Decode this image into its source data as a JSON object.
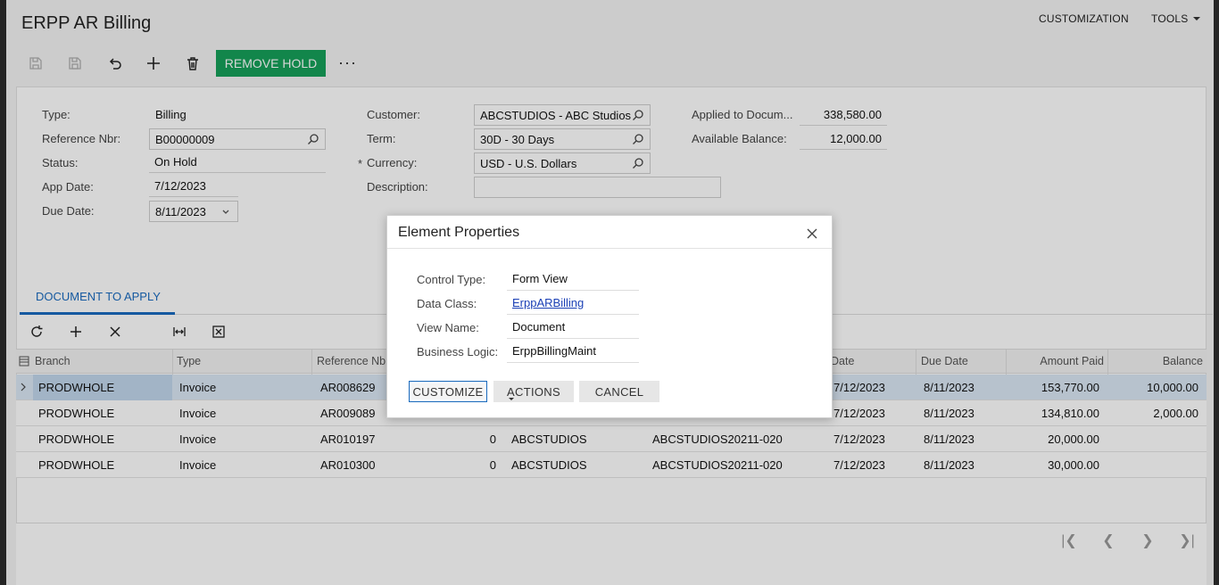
{
  "app": {
    "title": "ERPP AR Billing",
    "menu": {
      "customization": "CUSTOMIZATION",
      "tools": "TOOLS"
    },
    "toolbar": {
      "remove_hold": "REMOVE HOLD",
      "more": "···"
    }
  },
  "form": {
    "type": {
      "label": "Type:",
      "value": "Billing"
    },
    "ref_nbr": {
      "label": "Reference Nbr:",
      "value": "B00000009"
    },
    "status": {
      "label": "Status:",
      "value": "On Hold"
    },
    "app_date": {
      "label": "App Date:",
      "value": "7/12/2023"
    },
    "due_date": {
      "label": "Due Date:",
      "value": "8/11/2023"
    },
    "customer": {
      "label": "Customer:",
      "value": "ABCSTUDIOS - ABC Studios"
    },
    "term": {
      "label": "Term:",
      "value": "30D - 30 Days"
    },
    "currency": {
      "label": "Currency:",
      "value": "USD - U.S. Dollars"
    },
    "description": {
      "label": "Description:",
      "value": ""
    },
    "applied": {
      "label": "Applied to Docum...",
      "value": "338,580.00"
    },
    "available": {
      "label": "Available Balance:",
      "value": "12,000.00"
    }
  },
  "tab": {
    "label": "DOCUMENT TO APPLY"
  },
  "grid": {
    "headers": {
      "branch": "Branch",
      "type": "Type",
      "ref": "Reference Nb",
      "date": "Date",
      "due": "Due Date",
      "paid": "Amount Paid",
      "balance": "Balance"
    },
    "rows": [
      {
        "branch": "PRODWHOLE",
        "type": "Invoice",
        "ref": "AR008629",
        "num": "",
        "customer": "",
        "orig": "",
        "date": "7/12/2023",
        "due": "8/11/2023",
        "paid": "153,770.00",
        "balance": "10,000.00"
      },
      {
        "branch": "PRODWHOLE",
        "type": "Invoice",
        "ref": "AR009089",
        "num": "",
        "customer": "",
        "orig": "",
        "date": "7/12/2023",
        "due": "8/11/2023",
        "paid": "134,810.00",
        "balance": "2,000.00"
      },
      {
        "branch": "PRODWHOLE",
        "type": "Invoice",
        "ref": "AR010197",
        "num": "0",
        "customer": "ABCSTUDIOS",
        "orig": "ABCSTUDIOS20211-020",
        "date": "7/12/2023",
        "due": "8/11/2023",
        "paid": "20,000.00",
        "balance": ""
      },
      {
        "branch": "PRODWHOLE",
        "type": "Invoice",
        "ref": "AR010300",
        "num": "0",
        "customer": "ABCSTUDIOS",
        "orig": "ABCSTUDIOS20211-020",
        "date": "7/12/2023",
        "due": "8/11/2023",
        "paid": "30,000.00",
        "balance": ""
      }
    ]
  },
  "dialog": {
    "title": "Element Properties",
    "control_type": {
      "label": "Control Type:",
      "value": "Form View"
    },
    "data_class": {
      "label": "Data Class:",
      "value": "ErppARBilling"
    },
    "view_name": {
      "label": "View Name:",
      "value": "Document"
    },
    "business_logic": {
      "label": "Business Logic:",
      "value": "ErppBillingMaint"
    },
    "buttons": {
      "customize": "CUSTOMIZE",
      "actions": "ACTIONS",
      "cancel": "CANCEL"
    }
  }
}
